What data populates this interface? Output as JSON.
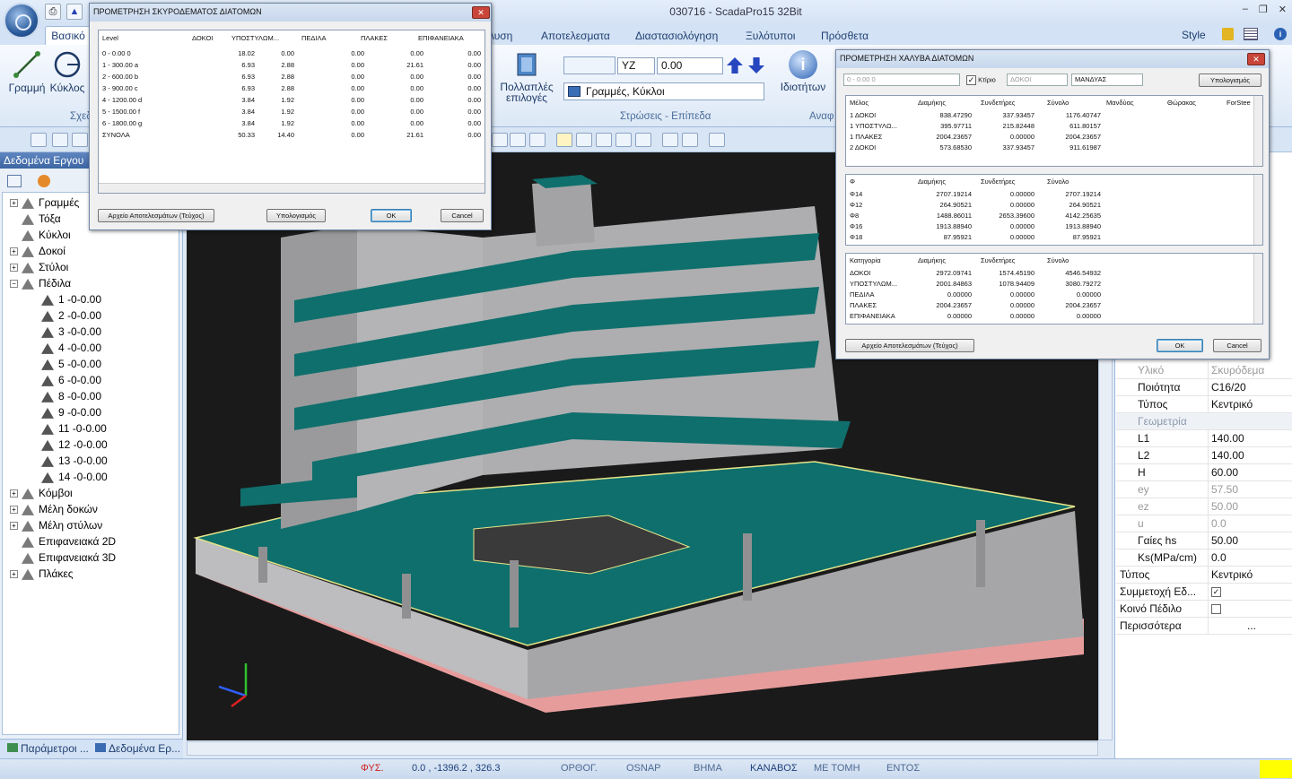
{
  "app": {
    "title": "030716 - ScadaPro15 32Bit",
    "style_label": "Style"
  },
  "ribbon": {
    "tabs": [
      "Βασικό",
      "λυση",
      "Αποτελεσματα",
      "Διαστασιολόγηση",
      "Ξυλότυποι",
      "Πρόσθετα"
    ],
    "buttons": {
      "line": "Γραμμή",
      "circle": "Κύκλος",
      "multi": "Πολλαπλές επιλογές",
      "props": "Ιδιοτήτων"
    },
    "group_draw": "Σχεδ",
    "group_layers": "Στρώσεις - Επίπεδα",
    "group_props": "Αναφ",
    "plane_axis": "YZ",
    "plane_value": "0.00",
    "layer_combo": "Γραμμές, Κύκλοι"
  },
  "left_panel": {
    "title": "Δεδομένα Εργου",
    "tree": [
      {
        "label": "Γραμμές",
        "level": 0,
        "exp": "+"
      },
      {
        "label": "Τόξα",
        "level": 0,
        "exp": ""
      },
      {
        "label": "Κύκλοι",
        "level": 0,
        "exp": ""
      },
      {
        "label": "Δοκοί",
        "level": 0,
        "exp": "+"
      },
      {
        "label": "Στύλοι",
        "level": 0,
        "exp": "+"
      },
      {
        "label": "Πέδιλα",
        "level": 0,
        "exp": "−"
      },
      {
        "label": "1 -0-0.00",
        "level": 1,
        "exp": ""
      },
      {
        "label": "2 -0-0.00",
        "level": 1,
        "exp": ""
      },
      {
        "label": "3 -0-0.00",
        "level": 1,
        "exp": ""
      },
      {
        "label": "4 -0-0.00",
        "level": 1,
        "exp": ""
      },
      {
        "label": "5 -0-0.00",
        "level": 1,
        "exp": ""
      },
      {
        "label": "6 -0-0.00",
        "level": 1,
        "exp": ""
      },
      {
        "label": "8 -0-0.00",
        "level": 1,
        "exp": ""
      },
      {
        "label": "9 -0-0.00",
        "level": 1,
        "exp": ""
      },
      {
        "label": "11 -0-0.00",
        "level": 1,
        "exp": ""
      },
      {
        "label": "12 -0-0.00",
        "level": 1,
        "exp": ""
      },
      {
        "label": "13 -0-0.00",
        "level": 1,
        "exp": ""
      },
      {
        "label": "14 -0-0.00",
        "level": 1,
        "exp": ""
      },
      {
        "label": "Κόμβοι",
        "level": 0,
        "exp": "+"
      },
      {
        "label": "Μέλη δοκών",
        "level": 0,
        "exp": "+"
      },
      {
        "label": "Μέλη στύλων",
        "level": 0,
        "exp": "+"
      },
      {
        "label": "Επιφανειακά 2D",
        "level": 0,
        "exp": ""
      },
      {
        "label": "Επιφανειακά 3D",
        "level": 0,
        "exp": ""
      },
      {
        "label": "Πλάκες",
        "level": 0,
        "exp": "+"
      }
    ],
    "tabs": [
      "Παράμετροι ...",
      "Δεδομένα Ερ..."
    ]
  },
  "concrete_dialog": {
    "title": "ΠΡΟΜΕΤΡΗΣΗ ΣΚΥΡΟΔΕΜΑΤΟΣ ΔΙΑΤΟΜΩΝ",
    "columns": [
      "Level",
      "ΔΟΚΟΙ",
      "ΥΠΟΣΤΥΛΩΜ...",
      "ΠΕΔΙΛΑ",
      "ΠΛΑΚΕΣ",
      "ΕΠΙΦΑΝΕΙΑΚΑ"
    ],
    "rows": [
      [
        "0 - 0.00 0",
        "18.02",
        "0.00",
        "0.00",
        "0.00",
        "0.00"
      ],
      [
        "1 - 300.00 a",
        "6.93",
        "2.88",
        "0.00",
        "21.61",
        "0.00"
      ],
      [
        "2 - 600.00 b",
        "6.93",
        "2.88",
        "0.00",
        "0.00",
        "0.00"
      ],
      [
        "3 - 900.00 c",
        "6.93",
        "2.88",
        "0.00",
        "0.00",
        "0.00"
      ],
      [
        "4 - 1200.00 d",
        "3.84",
        "1.92",
        "0.00",
        "0.00",
        "0.00"
      ],
      [
        "5 - 1500.00 f",
        "3.84",
        "1.92",
        "0.00",
        "0.00",
        "0.00"
      ],
      [
        "6 - 1800.00 g",
        "3.84",
        "1.92",
        "0.00",
        "0.00",
        "0.00"
      ],
      [
        "ΣΥΝΟΛΑ",
        "50.33",
        "14.40",
        "0.00",
        "21.61",
        "0.00"
      ]
    ],
    "btn_file": "Αρχείο Αποτελεσμάτων (Τεύχος)",
    "btn_calc": "Υπολογισμός",
    "btn_ok": "OK",
    "btn_cancel": "Cancel"
  },
  "steel_dialog": {
    "title": "ΠΡΟΜΕΤΡΗΣΗ ΧΑΛΥΒΑ ΔΙΑΤΟΜΩΝ",
    "filter_level": "0 - 0.00 0",
    "filter_building": "Κτίριο",
    "filter_type": "ΔΟΚΟΙ",
    "filter_rebar": "ΜΑΝΔΥΑΣ",
    "btn_calc": "Υπολογισμός",
    "grid1_cols": [
      "Μέλος",
      "Διαμήκης",
      "Συνδετήρες",
      "Σύνολο",
      "Μανδύας",
      "Θώρακας",
      "ForStee"
    ],
    "grid1_rows": [
      [
        "1 ΔΟΚΟΙ",
        "838.47290",
        "337.93457",
        "1176.40747"
      ],
      [
        "1 ΥΠΟΣΤΥΛΩ...",
        "395.97711",
        "215.82448",
        "611.80157"
      ],
      [
        "1 ΠΛΑΚΕΣ",
        "2004.23657",
        "0.00000",
        "2004.23657"
      ],
      [
        "2 ΔΟΚΟΙ",
        "573.68530",
        "337.93457",
        "911.61987"
      ]
    ],
    "grid2_cols": [
      "Φ",
      "Διαμήκης",
      "Συνδετήρες",
      "Σύνολο"
    ],
    "grid2_rows": [
      [
        "Φ14",
        "2707.19214",
        "0.00000",
        "2707.19214"
      ],
      [
        "Φ12",
        "264.90521",
        "0.00000",
        "264.90521"
      ],
      [
        "Φ8",
        "1488.86011",
        "2653.39600",
        "4142.25635"
      ],
      [
        "Φ16",
        "1913.88940",
        "0.00000",
        "1913.88940"
      ],
      [
        "Φ18",
        "87.95921",
        "0.00000",
        "87.95921"
      ]
    ],
    "grid3_cols": [
      "Κατηγορία",
      "Διαμήκης",
      "Συνδετήρες",
      "Σύνολο"
    ],
    "grid3_rows": [
      [
        "ΔΟΚΟΙ",
        "2972.09741",
        "1574.45190",
        "4546.54932"
      ],
      [
        "ΥΠΟΣΤΥΛΩΜ...",
        "2001.84863",
        "1078.94409",
        "3080.79272"
      ],
      [
        "ΠΕΔΙΛΑ",
        "0.00000",
        "0.00000",
        "0.00000"
      ],
      [
        "ΠΛΑΚΕΣ",
        "2004.23657",
        "0.00000",
        "2004.23657"
      ],
      [
        "ΕΠΙΦΑΝΕΙΑΚΑ",
        "0.00000",
        "0.00000",
        "0.00000"
      ]
    ],
    "btn_file": "Αρχείο Αποτελεσμάτων (Τεύχος)",
    "btn_ok": "OK",
    "btn_cancel": "Cancel"
  },
  "properties": [
    {
      "key": "Υλικό",
      "value": "Σκυρόδεμα",
      "style": "grey"
    },
    {
      "key": "Ποιότητα",
      "value": "C16/20",
      "style": ""
    },
    {
      "key": "Τύπος",
      "value": "Κεντρικό",
      "style": ""
    },
    {
      "key": "Γεωμετρία",
      "value": "",
      "style": "head"
    },
    {
      "key": "L1",
      "value": "140.00",
      "style": ""
    },
    {
      "key": "L2",
      "value": "140.00",
      "style": ""
    },
    {
      "key": "H",
      "value": "60.00",
      "style": ""
    },
    {
      "key": "ey",
      "value": "57.50",
      "style": "grey"
    },
    {
      "key": "ez",
      "value": "50.00",
      "style": "grey"
    },
    {
      "key": "u",
      "value": "0.0",
      "style": "grey"
    },
    {
      "key": "Γαίες hs",
      "value": "50.00",
      "style": ""
    },
    {
      "key": "Ks(MPa/cm)",
      "value": "0.0",
      "style": ""
    },
    {
      "key": "Τύπος",
      "value": "Κεντρικό",
      "style": "root"
    },
    {
      "key": "Συμμετοχή Εδ...",
      "value": "✓",
      "style": "root check"
    },
    {
      "key": "Κοινό Πέδιλο",
      "value": "",
      "style": "root check"
    },
    {
      "key": "Περισσότερα",
      "value": "...",
      "style": "root"
    }
  ],
  "status": {
    "fys": "ΦΥΣ.",
    "coords": "0.0 , -1396.2 , 326.3",
    "items": [
      "ΟΡΘΟΓ.",
      "OSNAP",
      "ΒΗΜΑ",
      "ΚΑΝΑΒΟΣ",
      "ΜΕ ΤΟΜΗ",
      "ΕΝΤΟΣ"
    ]
  },
  "colors": {
    "slab": "#0f6f6c",
    "wall": "#a9a9ab",
    "footing": "#e79c9c",
    "background": "#1a1a1a"
  }
}
